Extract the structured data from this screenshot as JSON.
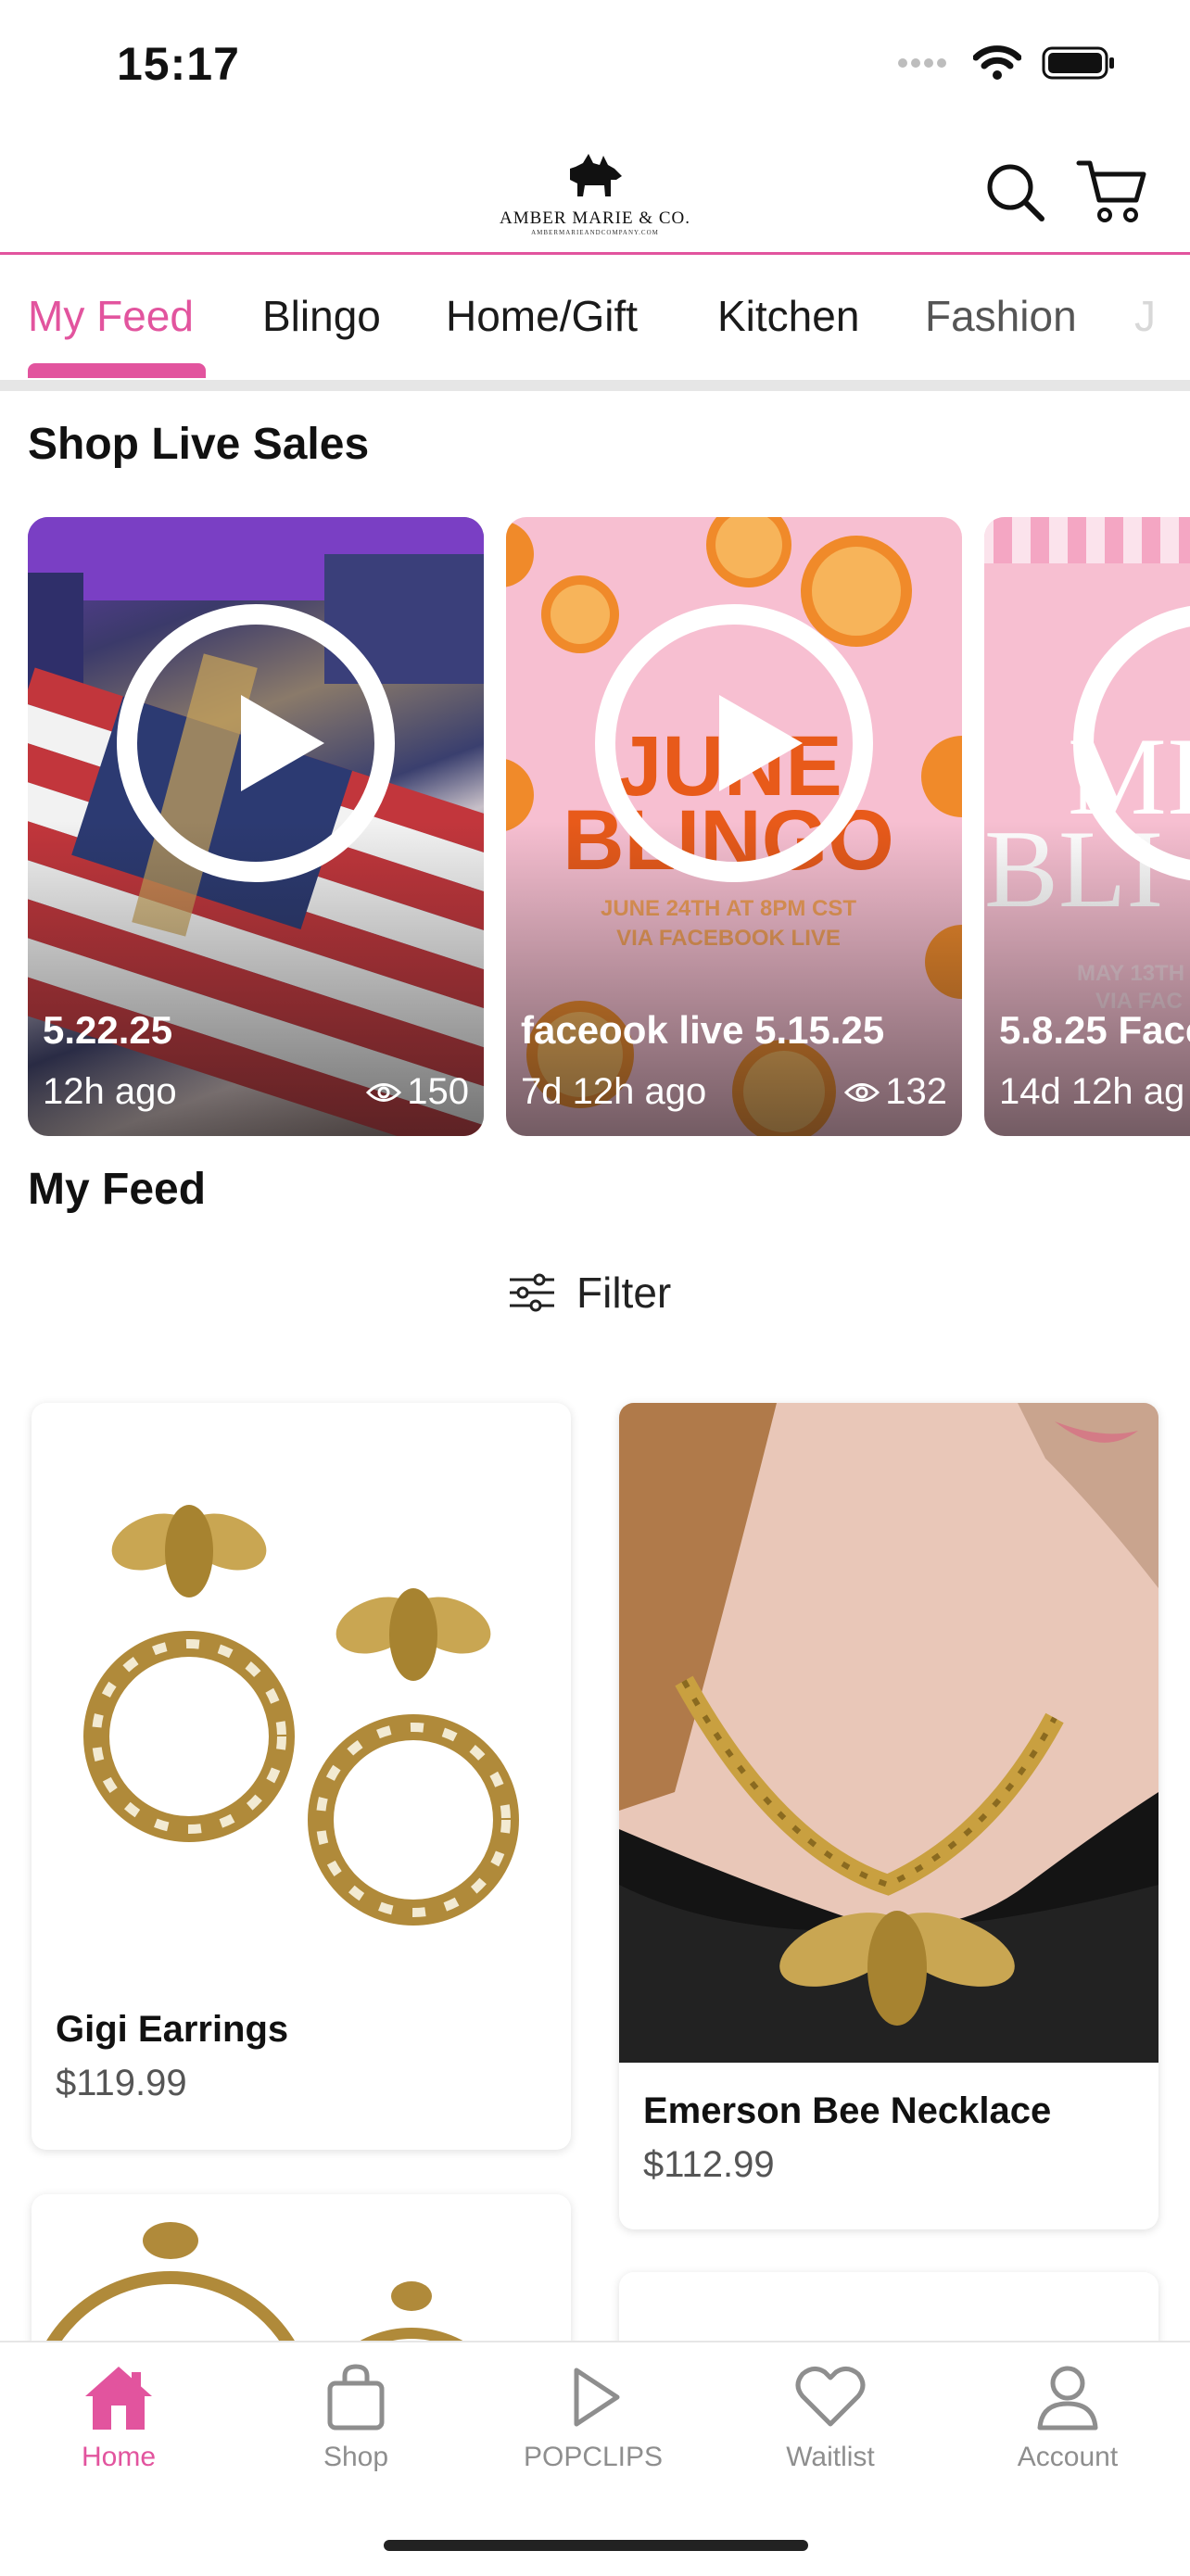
{
  "status_bar": {
    "time": "15:17"
  },
  "header": {
    "logo_title": "AMBER MARIE & CO.",
    "logo_subtitle": "AMBERMARIEANDCOMPANY.COM"
  },
  "tabs": [
    "My Feed",
    "Blingo",
    "Home/Gift",
    "Kitchen",
    "Fashion",
    "J"
  ],
  "active_tab": "My Feed",
  "live_section": {
    "title": "Shop Live Sales",
    "cards": [
      {
        "title": "5.22.25",
        "age": "12h ago",
        "views": "150"
      },
      {
        "title": "faceook live 5.15.25",
        "age": "7d 12h ago",
        "views": "132",
        "poster_heading": "JUNE BLINGO",
        "poster_subtext_1": "JUNE 24TH AT 8PM CST",
        "poster_subtext_2": "VIA FACEBOOK LIVE"
      },
      {
        "title": "5.8.25 Face",
        "age": "14d 12h ag",
        "views": "",
        "poster_heading": "MI BLI",
        "poster_subtext_1": "MAY 13TH",
        "poster_subtext_2": "VIA FAC"
      }
    ]
  },
  "feed": {
    "title": "My Feed",
    "filter_label": "Filter",
    "products": [
      {
        "name": "Gigi Earrings",
        "price": "$119.99"
      },
      {
        "name": "Emerson Bee Necklace",
        "price": "$112.99"
      }
    ]
  },
  "bottom_nav": [
    {
      "label": "Home",
      "icon": "home-icon",
      "active": true
    },
    {
      "label": "Shop",
      "icon": "shopping-bag-icon",
      "active": false
    },
    {
      "label": "POPCLIPS",
      "icon": "play-icon",
      "active": false
    },
    {
      "label": "Waitlist",
      "icon": "heart-icon",
      "active": false
    },
    {
      "label": "Account",
      "icon": "user-icon",
      "active": false
    }
  ],
  "colors": {
    "accent": "#e2549e",
    "divider": "#e6e6e6",
    "nav_inactive": "#8e8e8e"
  }
}
